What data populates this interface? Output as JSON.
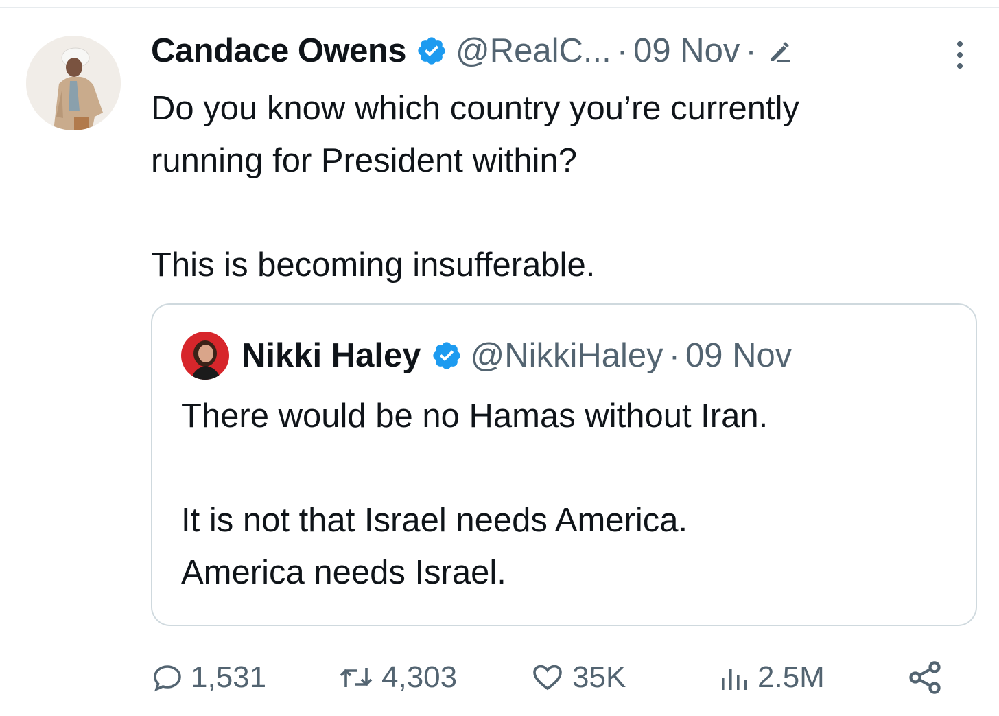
{
  "tweet": {
    "author_name": "Candace Owens",
    "handle": "@RealC...",
    "separator": "·",
    "date": "09 Nov",
    "separator_2": "·",
    "text_line1": "Do you know which country you’re currently",
    "text_line2": "running for President within?",
    "text_line3": "This is becoming insufferable."
  },
  "quoted_tweet": {
    "author_name": "Nikki Haley",
    "handle": "@NikkiHaley",
    "separator": "·",
    "date": "09 Nov",
    "text_line1": "There would be no Hamas without Iran.",
    "text_line2": "It is not that Israel needs America.",
    "text_line3": "America needs Israel."
  },
  "actions": {
    "replies": "1,531",
    "reposts": "4,303",
    "likes": "35K",
    "views": "2.5M"
  },
  "colors": {
    "verified_blue": "#1d9bf0",
    "secondary_text": "#536471",
    "border": "#cfd9de"
  },
  "icons": [
    "verified-badge-icon",
    "edit-icon",
    "more-icon",
    "reply-icon",
    "repost-icon",
    "like-icon",
    "views-icon",
    "share-icon"
  ]
}
